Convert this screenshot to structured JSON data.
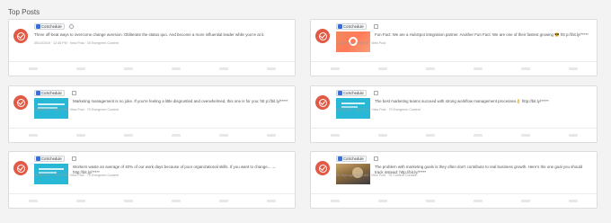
{
  "section_title": "Top Posts",
  "accent": "#e05a46",
  "posts": [
    {
      "tag": "CoSchedule",
      "type_icon": "link-icon",
      "text": "Three off-beat ways to overcome change aversion. Obliterate the status quo. And become a more influential leader while you're at it.",
      "meta": "05/14/2019 · 12:45 PM · View Post · 30 Evergreen Content",
      "thumb": null
    },
    {
      "tag": "CoSchedule",
      "type_icon": "image-icon",
      "text": "Fun Fact: We are a HubSpot integration partner. Another Fun Fact: We are one of their fastest growing 😎 htt p://bit.ly/*****",
      "meta": "11 days ago · 9:19 PM · View Post",
      "thumb": "hubspot"
    },
    {
      "tag": "CoSchedule",
      "type_icon": "image-icon",
      "text": "Marketing management is no joke. If you're feeling a little disgruntled and overwhelmed, this one is for you: htt p://bit.ly/*****",
      "meta": "05/30/2019 · 12:00 PM · View Post · 70 Evergreen Content",
      "thumb": "teal"
    },
    {
      "tag": "CoSchedule",
      "type_icon": "image-icon",
      "text": "The best marketing teams succeed with strong workflow management processes👌 http://bit.ly/*****",
      "meta": "05/15/2019 · 10:01 AM · View Post · 70 Evergreen Content",
      "thumb": "teal"
    },
    {
      "tag": "CoSchedule",
      "type_icon": "image-icon",
      "text": "Workers waste an average of 40% of our work days because of poor organizational skills. If you want to change... → http://bit.ly/*****",
      "meta": "06/03/2019 · 12:07 PM · View Post · 70 Evergreen Content",
      "thumb": "teal"
    },
    {
      "tag": "CoSchedule",
      "type_icon": "image-icon",
      "text": "The problem with marketing goals is they often don't contribute to real business growth. Here's the one goal you should track instead: http://bit.ly/*****",
      "meta": "16 days ago · 8:53 AM · View Post · 70 Content Curation",
      "thumb": "photo"
    }
  ]
}
